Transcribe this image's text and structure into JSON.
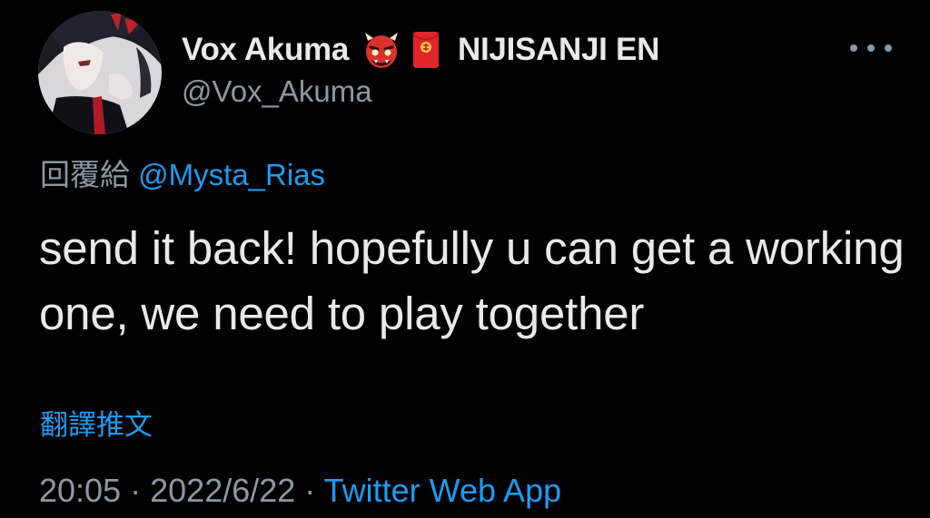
{
  "tweet": {
    "author": {
      "display_name": "Vox Akuma",
      "badge_emojis": [
        "ogre-emoji",
        "red-envelope-emoji"
      ],
      "affiliation": "NIJISANJI EN",
      "handle": "@Vox_Akuma",
      "avatar": "avatar"
    },
    "reply_prefix": "回覆給",
    "reply_to": "@Mysta_Rias",
    "text": "send it back! hopefully u can get a working one, we need to play together",
    "translate_label": "翻譯推文",
    "time": "20:05",
    "separator": "·",
    "date": "2022/6/22",
    "source_app": "Twitter Web App",
    "more_icon": "more-icon"
  },
  "colors": {
    "background": "#000000",
    "primary_text": "#e7e9ea",
    "secondary_text": "#8b98a5",
    "link": "#1d9bf0"
  }
}
